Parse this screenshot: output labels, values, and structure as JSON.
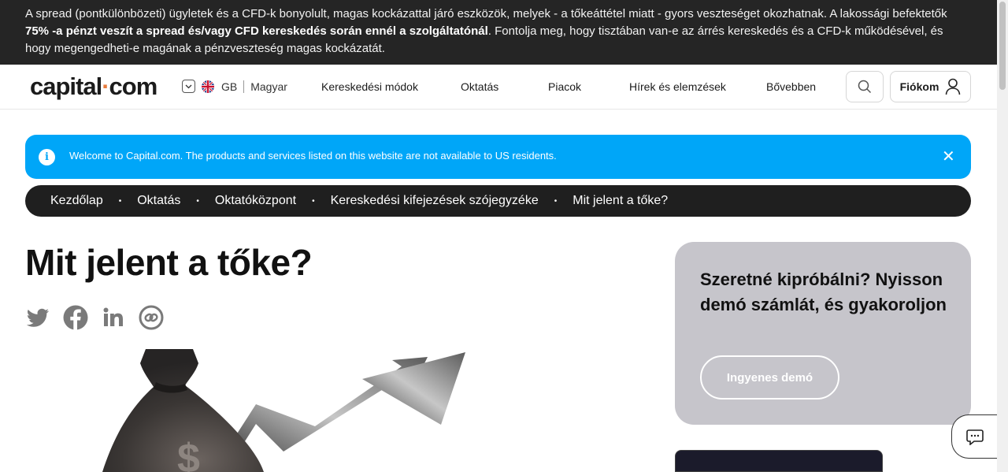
{
  "risk_warning": {
    "text_before": "A spread (pontkülönbözeti) ügyletek és a CFD-k bonyolult, magas kockázattal járó eszközök, melyek - a tőkeáttétel miatt - gyors veszteséget okozhatnak. A lakossági befektetők ",
    "text_bold": "75% -a pénzt veszít a spread és/vagy CFD kereskedés során ennél a szolgáltatónál",
    "text_after": ". Fontolja meg, hogy tisztában van-e az árrés kereskedés és a CFD-k működésével, és hogy megengedheti-e magának a pénzveszteség magas kockázatát."
  },
  "header": {
    "logo_left": "capital",
    "logo_dot": "·",
    "logo_right": "com",
    "locale_country": "GB",
    "locale_language": "Magyar",
    "nav": [
      "Kereskedési módok",
      "Oktatás",
      "Piacok",
      "Hírek és elemzések",
      "Bővebben"
    ],
    "account_label": "Fiókom"
  },
  "notice": {
    "info_glyph": "i",
    "message": "Welcome to Capital.com. The products and services listed on this website are not available to US residents.",
    "close_glyph": "✕"
  },
  "breadcrumb": [
    "Kezdőlap",
    "Oktatás",
    "Oktatóközpont",
    "Kereskedési kifejezések szójegyzéke",
    "Mit jelent a tőke?"
  ],
  "breadcrumb_separator": "•",
  "page": {
    "title": "Mit jelent a tőke?",
    "share_icons": [
      "twitter-icon",
      "facebook-icon",
      "linkedin-icon",
      "copy-link-icon"
    ]
  },
  "promo": {
    "heading": "Szeretné kipróbálni? Nyisson demó számlát, és gyakoroljon",
    "button": "Ingyenes demó"
  },
  "colors": {
    "risk_bar_bg": "#252525",
    "notice_bg": "#00a6f8",
    "breadcrumb_bg": "#1f1f1f",
    "promo_bg": "#c6c5cb",
    "logo_accent": "#e77b3c"
  }
}
